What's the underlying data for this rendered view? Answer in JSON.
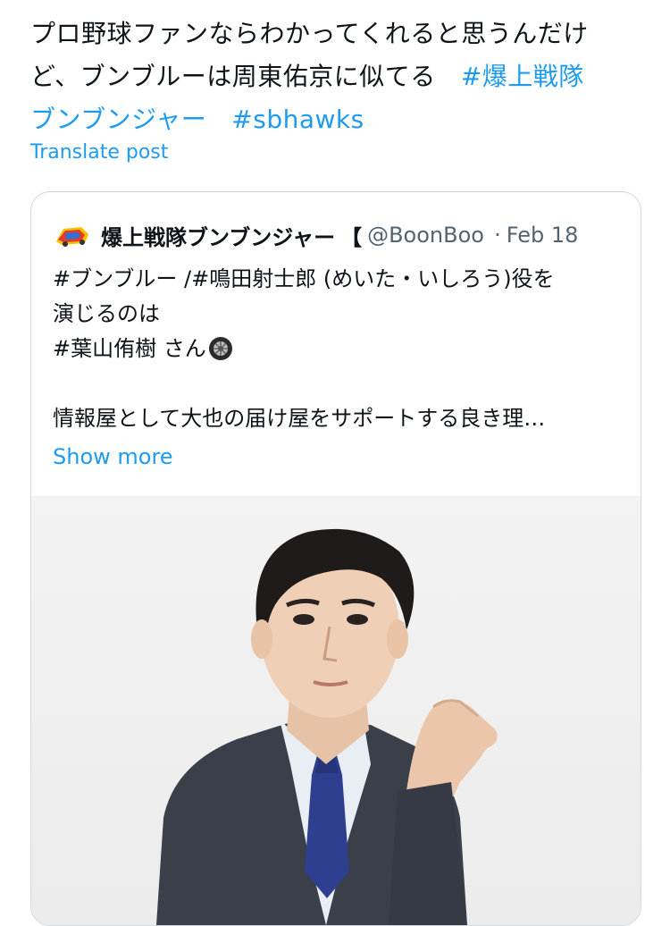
{
  "post": {
    "text_line1": "プロ野球ファンならわかってくれると思うんだけ",
    "text_line2": "ど、ブンブルーは周東佑京に似てる",
    "hashtag1_part1": "#爆上戦隊",
    "hashtag1_part2": "ブンブンジャー",
    "hashtag2": "#sbhawks",
    "translate_label": "Translate post"
  },
  "quote": {
    "display_name": "爆上戦隊ブンブンジャー",
    "name_suffix": "【",
    "handle": "@BoonBoo",
    "separator": "·",
    "date": "Feb 18",
    "body_line1": "#ブンブルー /#鳴田射士郎 (めいた・いしろう)役を",
    "body_line2": "演じるのは",
    "body_line3": "#葉山侑樹 さん",
    "body_line4": "情報屋として大也の届け屋をサポートする良き理…",
    "show_more": "Show more",
    "emoji_icon": "tire-icon",
    "image_icon": "person-portrait-photo"
  },
  "colors": {
    "link": "#1d9bf0",
    "text": "#0f1419",
    "secondary": "#536471",
    "border": "#cfd9de"
  }
}
